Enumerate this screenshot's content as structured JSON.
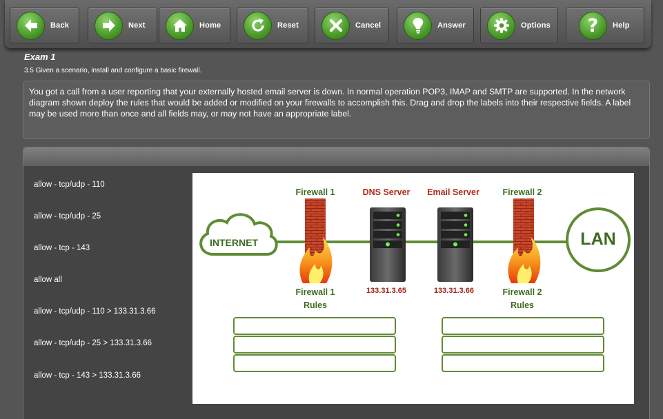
{
  "toolbar": {
    "buttons": [
      {
        "label": "Back",
        "icon": "arrow-left-icon"
      },
      {
        "label": "Next",
        "icon": "arrow-right-icon"
      },
      {
        "label": "Home",
        "icon": "home-icon"
      },
      {
        "label": "Reset",
        "icon": "reset-icon"
      },
      {
        "label": "Cancel",
        "icon": "x-icon"
      },
      {
        "label": "Answer",
        "icon": "lightbulb-icon"
      },
      {
        "label": "Options",
        "icon": "gear-icon"
      },
      {
        "label": "Help",
        "icon": "question-icon"
      }
    ]
  },
  "exam": {
    "title": "Exam 1",
    "objective": "3.5 Given a scenario, install and configure a basic firewall.",
    "question": "You got a call from a user reporting that your externally hosted email server is down. In normal operation POP3, IMAP and SMTP are supported. In the network diagram shown deploy the rules that would be added or modified on your firewalls to accomplish this. Drag and drop the labels into their respective fields. A label may be used more than once and all fields may, or may not have an appropriate label."
  },
  "labels": [
    "allow - tcp/udp - 110",
    "allow - tcp/udp - 25",
    "allow - tcp - 143",
    "allow all",
    "allow - tcp/udp - 110 > 133.31.3.66",
    "allow - tcp/udp - 25 > 133.31.3.66",
    "allow - tcp - 143 > 133.31.3.66"
  ],
  "diagram": {
    "internet": "INTERNET",
    "lan": "LAN",
    "firewall1": "Firewall 1",
    "dns_server": "DNS Server",
    "email_server": "Email Server",
    "firewall2": "Firewall 2",
    "fw1_rules_line1": "Firewall 1",
    "fw1_rules_line2": "Rules",
    "fw2_rules_line1": "Firewall 2",
    "fw2_rules_line2": "Rules",
    "dns_ip": "133.31.3.65",
    "email_ip": "133.31.3.66"
  },
  "colors": {
    "accent_green": "#5f8c35",
    "server_label_red": "#b02a17"
  }
}
